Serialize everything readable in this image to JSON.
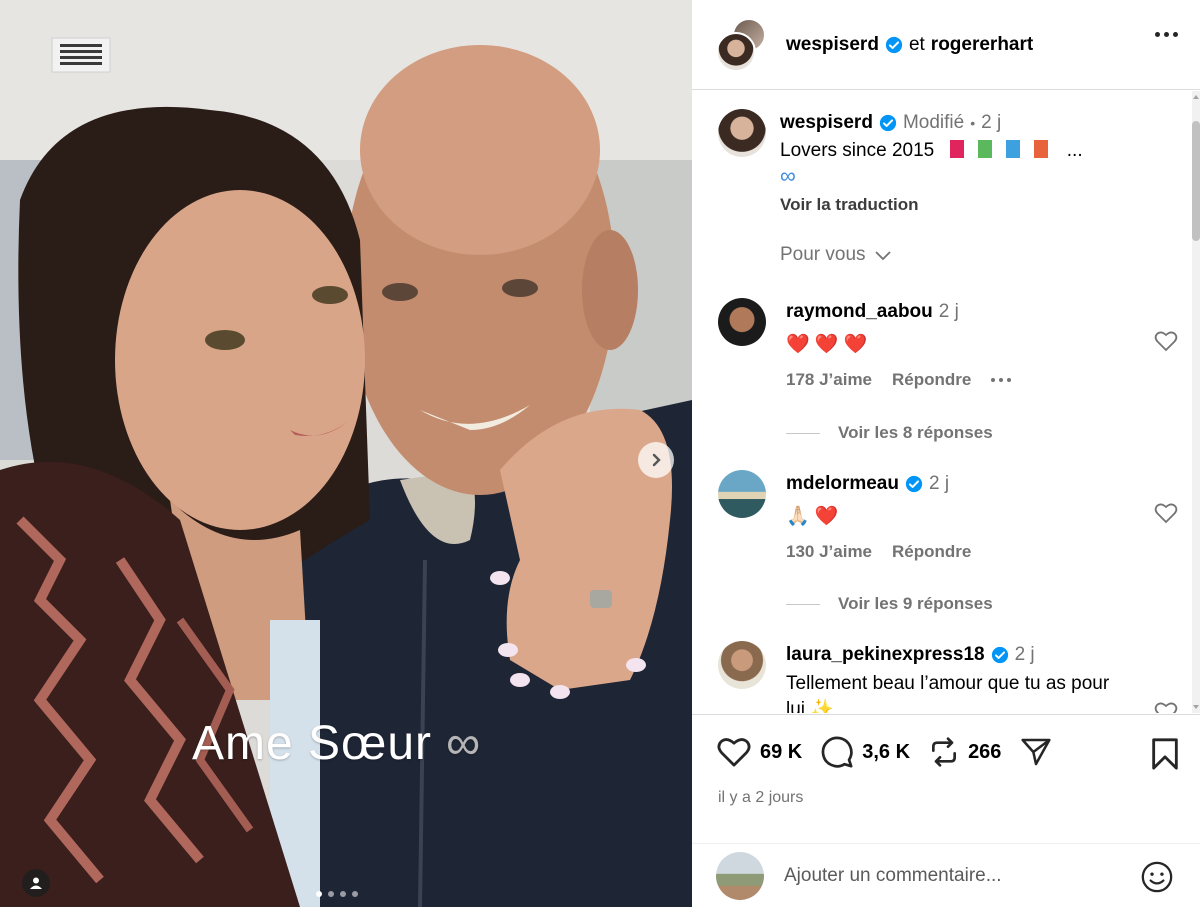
{
  "media": {
    "overlay_text": "Ame Sœur",
    "overlay_symbol": "∞",
    "carousel_total": 4,
    "carousel_active": 1
  },
  "header": {
    "author": "wespiserd",
    "joiner": "et",
    "coauthor": "rogererhart"
  },
  "caption": {
    "username": "wespiserd",
    "edited_label": "Modifié",
    "separator": "•",
    "age": "2 j",
    "text": "Lovers since 2015",
    "ellipsis": "...",
    "second_line_symbol": "∞",
    "see_translation": "Voir la traduction",
    "square_colors": [
      "#e0245e",
      "#5cb85c",
      "#3da1e0",
      "#e8623b"
    ]
  },
  "sort": {
    "label": "Pour vous"
  },
  "comments": [
    {
      "username": "raymond_aabou",
      "verified": false,
      "age": "2 j",
      "text": "❤️ ❤️ ❤️",
      "likes": "178 J’aime",
      "reply": "Répondre",
      "view_replies": "Voir les 8 réponses"
    },
    {
      "username": "mdelormeau",
      "verified": true,
      "age": "2 j",
      "text": "🙏🏻 ❤️",
      "likes": "130 J’aime",
      "reply": "Répondre",
      "view_replies": "Voir les 9 réponses"
    },
    {
      "username": "laura_pekinexpress18",
      "verified": true,
      "age": "2 j",
      "text": "Tellement beau l’amour que tu as pour lui ✨"
    }
  ],
  "actions": {
    "likes": "69 K",
    "comments": "3,6 K",
    "reposts": "266",
    "date": "il y a 2 jours"
  },
  "composer": {
    "placeholder": "Ajouter un commentaire..."
  },
  "colors": {
    "verified": "#0095f6",
    "muted": "#737373",
    "border": "#dbdbdb"
  }
}
